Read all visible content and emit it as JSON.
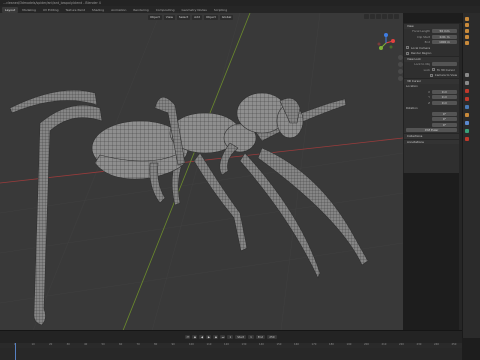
{
  "app": {
    "title": "…cleaned/3dmodels/spider/ant/ant_lowpoly.blend - Blender 4"
  },
  "workspaces": [
    "Layout",
    "Modeling",
    "UV Editing",
    "Texture Paint",
    "Shading",
    "Animation",
    "Rendering",
    "Compositing",
    "Geometry Nodes",
    "Scripting"
  ],
  "viewport_header": {
    "mode": "Object",
    "view_menu": "View",
    "select_menu": "Select",
    "add_menu": "Add",
    "object_menu": "Object",
    "transform": "Global"
  },
  "n_panel": {
    "view_section": "View",
    "focal_length_label": "Focal Length",
    "focal_length": "50 mm",
    "clip_start_label": "Clip Start",
    "clip_start": "0.01 m",
    "clip_end_label": "End",
    "clip_end": "1000 m",
    "local_camera_label": "Local Camera",
    "render_region_label": "Render Region",
    "view_lock_label": "View Lock",
    "lock_to_object_label": "Lock to Obj",
    "lock_label": "Lock",
    "to_3d_cursor_label": "To 3D Cursor",
    "camera_to_view_label": "Camera to View",
    "cursor_section": "3D Cursor",
    "location_label": "Location",
    "x_label": "X",
    "x": "0 m",
    "y_label": "Y",
    "y": "0 m",
    "z_label": "Z",
    "z": "0 m",
    "rotation_label": "Rotation",
    "rx": "0°",
    "ry": "0°",
    "rz": "0°",
    "mode_label": "XYZ Euler",
    "collections_section": "Collections",
    "annotations_section": "Annotations"
  },
  "timeline": {
    "current_frame": "1",
    "start_label": "Start",
    "start": "1",
    "end_label": "End",
    "end": "250",
    "ticks": [
      "0",
      "10",
      "20",
      "30",
      "40",
      "50",
      "60",
      "70",
      "80",
      "90",
      "100",
      "110",
      "120",
      "130",
      "140",
      "150",
      "160",
      "170",
      "180",
      "190",
      "200",
      "210",
      "220",
      "230",
      "240",
      "250"
    ]
  },
  "colors": {
    "viewport_bg": "#393939",
    "mesh_fill": "#8a8a8a",
    "wire": "#2a2a2a",
    "axis_x": "#9b3b3b",
    "axis_y": "#6b8a2c",
    "playhead": "#5680c2",
    "gizmo_x": "#e3413f",
    "gizmo_y": "#7fb236",
    "gizmo_z": "#3f7de3"
  },
  "icons": [
    "object-mode-icon",
    "navigation-gizmo-icon",
    "zoom-icon",
    "hand-pan-icon",
    "camera-icon",
    "perspective-icon",
    "play-icon",
    "jump-start-icon",
    "jump-end-icon",
    "keyframe-prev-icon",
    "keyframe-next-icon"
  ]
}
